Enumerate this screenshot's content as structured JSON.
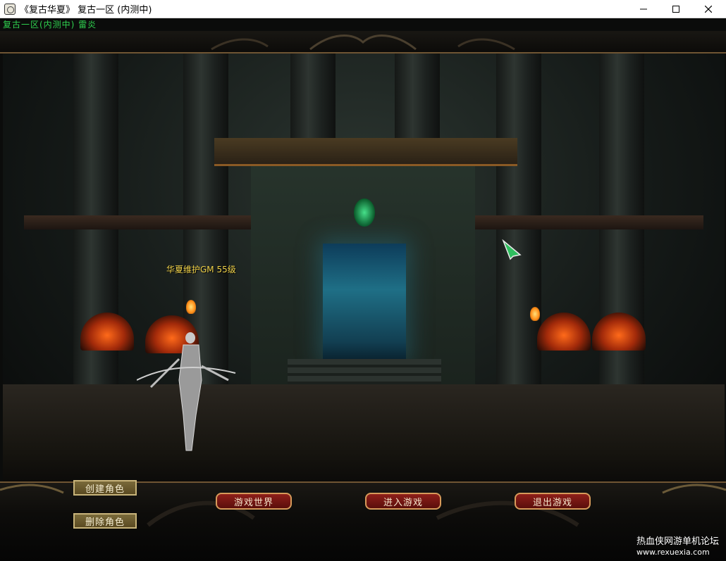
{
  "window": {
    "title": "《复古华夏》 复古一区 (内测中)",
    "icon": "app-seal-icon"
  },
  "game": {
    "server_line": "复古一区(内测中) 雷炎",
    "character": {
      "name_level": "华夏维护GM 55级"
    },
    "buttons": {
      "create_role": "创建角色",
      "delete_role": "删除角色",
      "game_world": "游戏世界",
      "enter_game": "进入游戏",
      "exit_game": "退出游戏"
    }
  },
  "watermark": {
    "name": "热血侠网游单机论坛",
    "url": "www.rexuexia.com"
  }
}
